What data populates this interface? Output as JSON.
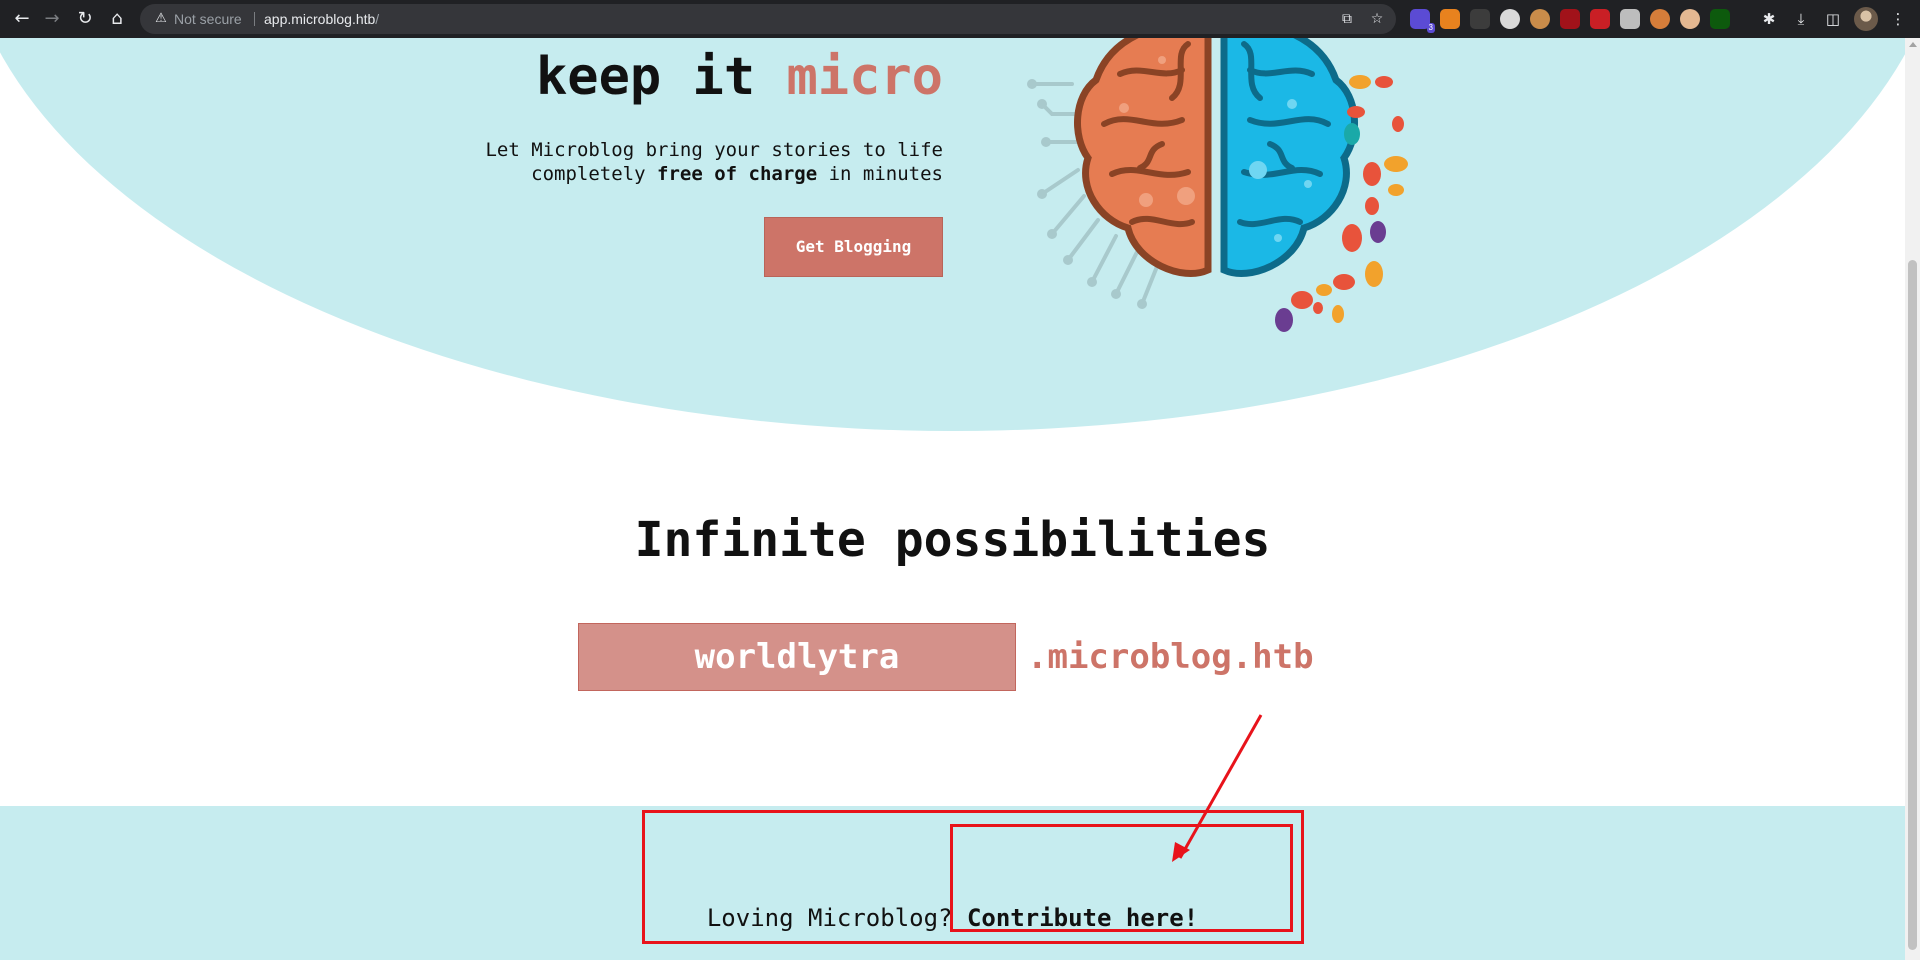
{
  "browser": {
    "security_label": "Not secure",
    "url_host": "app.microblog.htb",
    "url_path": "/",
    "extension_badge": "3",
    "icons": [
      "back-icon",
      "forward-icon",
      "reload-icon",
      "home-icon",
      "warning-icon",
      "share-icon",
      "bookmark-star-icon",
      "extensions-puzzle-icon",
      "download-icon",
      "side-panel-icon",
      "menu-kebab-icon"
    ]
  },
  "hero": {
    "title_plain": "keep it ",
    "title_accent": "micro",
    "subtitle_line1": "Let Microblog bring your stories to life",
    "subtitle_line2_prefix": "completely ",
    "subtitle_line2_bold": "free of charge",
    "subtitle_line2_suffix": " in minutes",
    "cta_label": "Get Blogging"
  },
  "possibilities": {
    "title": "Infinite possibilities",
    "subdomain_value": "worldlytra",
    "domain_suffix": ".microblog.htb"
  },
  "footer": {
    "prefix": "Loving Microblog? ",
    "link_label": "Contribute here!"
  },
  "colors": {
    "accent": "#cd7468",
    "hero_background": "#c6ecef",
    "annotation": "#e8131b",
    "brain_left": "#e67c52",
    "brain_right": "#1bb8e6"
  }
}
